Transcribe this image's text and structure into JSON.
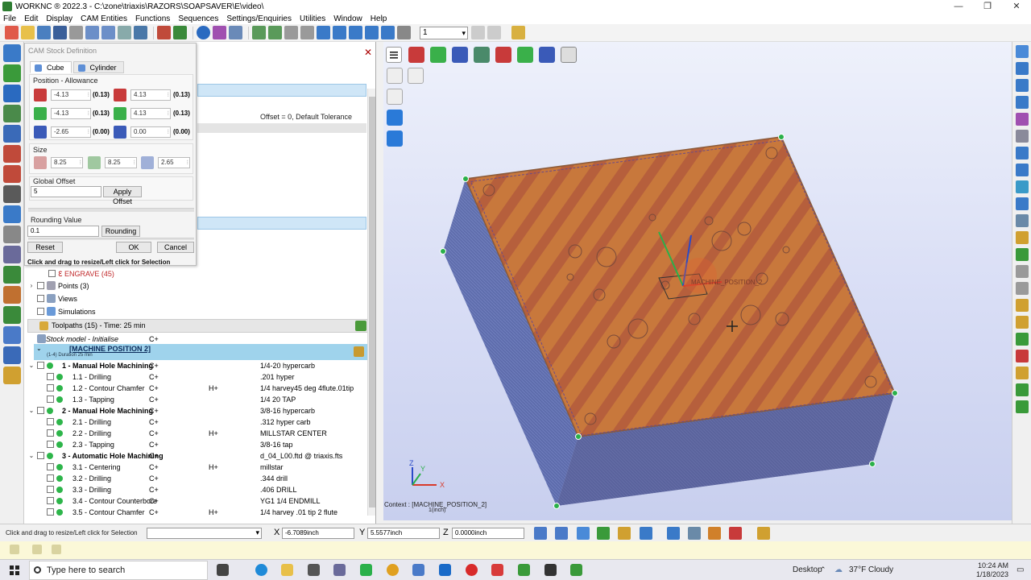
{
  "window": {
    "title": "WORKNC ® 2022.3 - C:\\zone\\triaxis\\RAZORS\\SOAPSAVER\\E\\video\\",
    "controls": [
      "—",
      "❐",
      "✕"
    ]
  },
  "menu": [
    "File",
    "Edit",
    "Display",
    "CAM Entities",
    "Functions",
    "Sequences",
    "Settings/Enquiries",
    "Utilities",
    "Window",
    "Help"
  ],
  "toolbar": {
    "combo_value": "1"
  },
  "dialog": {
    "title": "CAM Stock Definition",
    "tabs": [
      "Cube",
      "Cylinder"
    ],
    "position_label": "Position - Allowance",
    "rows": [
      {
        "a": "-4.13",
        "av": "(0.13)",
        "b": "4.13",
        "bv": "(0.13)"
      },
      {
        "a": "-4.13",
        "av": "(0.13)",
        "b": "4.13",
        "bv": "(0.13)"
      },
      {
        "a": "-2.65",
        "av": "(0.00)",
        "b": "0.00",
        "bv": "(0.00)"
      }
    ],
    "size_label": "Size",
    "size": [
      "8.25",
      "8.25",
      "2.65"
    ],
    "global_offset_label": "Global Offset",
    "global_offset_value": "5",
    "apply_offset": "Apply Offset",
    "rounding_label": "Rounding Value",
    "rounding_value": "0.1",
    "rounding_button": "Rounding",
    "reset": "Reset",
    "ok": "OK",
    "cancel": "Cancel",
    "hint": "Click and drag to resize/Left click for Selection"
  },
  "tree": {
    "offset_text": "Offset = 0, Default Tolerance",
    "engrave": "ENGRAVE (45)",
    "points": "Points (3)",
    "views": "Views",
    "simulations": "Simulations",
    "toolpaths_header": "Toolpaths (15) - Time: 25 min",
    "stock_model": "Stock model - Initialise",
    "stock_c": "C+",
    "machine": "[MACHINE POSITION 2]",
    "machine_sub": "(1-4) Duration 25 min",
    "items": [
      {
        "level": 1,
        "name": "1 - Manual Hole Machining",
        "c1": "C+",
        "c2": "",
        "c3": "1/4-20 hypercarb",
        "bold": true
      },
      {
        "level": 2,
        "name": "1.1 - Drilling",
        "c1": "C+",
        "c2": "",
        "c3": ".201 hyper"
      },
      {
        "level": 2,
        "name": "1.2 - Contour Chamfer",
        "c1": "C+",
        "c2": "H+",
        "c3": "1/4 harvey45 deg 4flute.01tip"
      },
      {
        "level": 2,
        "name": "1.3 - Tapping",
        "c1": "C+",
        "c2": "",
        "c3": "1/4 20 TAP"
      },
      {
        "level": 1,
        "name": "2 - Manual Hole Machining",
        "c1": "C+",
        "c2": "",
        "c3": "3/8-16 hypercarb"
      },
      {
        "level": 2,
        "name": "2.1 - Drilling",
        "c1": "C+",
        "c2": "",
        "c3": ".312 hyper carb"
      },
      {
        "level": 2,
        "name": "2.2 - Drilling",
        "c1": "C+",
        "c2": "H+",
        "c3": "MILLSTAR CENTER"
      },
      {
        "level": 2,
        "name": "2.3 - Tapping",
        "c1": "C+",
        "c2": "",
        "c3": "3/8-16 tap"
      },
      {
        "level": 1,
        "name": "3 - Automatic Hole Machining",
        "c1": "C+",
        "c2": "",
        "c3": "d_04_L00.ftd @ triaxis.fts"
      },
      {
        "level": 2,
        "name": "3.1 - Centering",
        "c1": "C+",
        "c2": "H+",
        "c3": "millstar"
      },
      {
        "level": 2,
        "name": "3.2 - Drilling",
        "c1": "C+",
        "c2": "",
        "c3": ".344 drill"
      },
      {
        "level": 2,
        "name": "3.3 - Drilling",
        "c1": "C+",
        "c2": "",
        "c3": ".406 DRILL"
      },
      {
        "level": 2,
        "name": "3.4 - Contour Counterbore",
        "c1": "C+",
        "c2": "",
        "c3": "YG1 1/4 ENDMILL"
      },
      {
        "level": 2,
        "name": "3.5 - Contour Chamfer",
        "c1": "C+",
        "c2": "H+",
        "c3": "1/4 harvey .01 tip 2 flute"
      }
    ]
  },
  "viewport": {
    "context": "Context : [MACHINE_POSITION_2]",
    "unit": "1(inch)",
    "axis_x": "X",
    "axis_y": "Y",
    "axis_z": "Z",
    "origin_label": "MACHINE_POSITION_2"
  },
  "statusbar": {
    "hint": "Click and drag to resize/Left click for Selection",
    "x_label": "X",
    "x_value": "-6.7089inch",
    "y_label": "Y",
    "y_value": "5.5577inch",
    "z_label": "Z",
    "z_value": "0.0000inch"
  },
  "taskbar": {
    "search_placeholder": "Type here to search",
    "desktop": "Desktop",
    "weather": "37°F  Cloudy",
    "time": "10:24 AM",
    "date": "1/18/2023"
  },
  "colors": {
    "accent": "#9fd3ec",
    "highlight": "#cfe6f7",
    "stock_face": "#c8783c"
  }
}
